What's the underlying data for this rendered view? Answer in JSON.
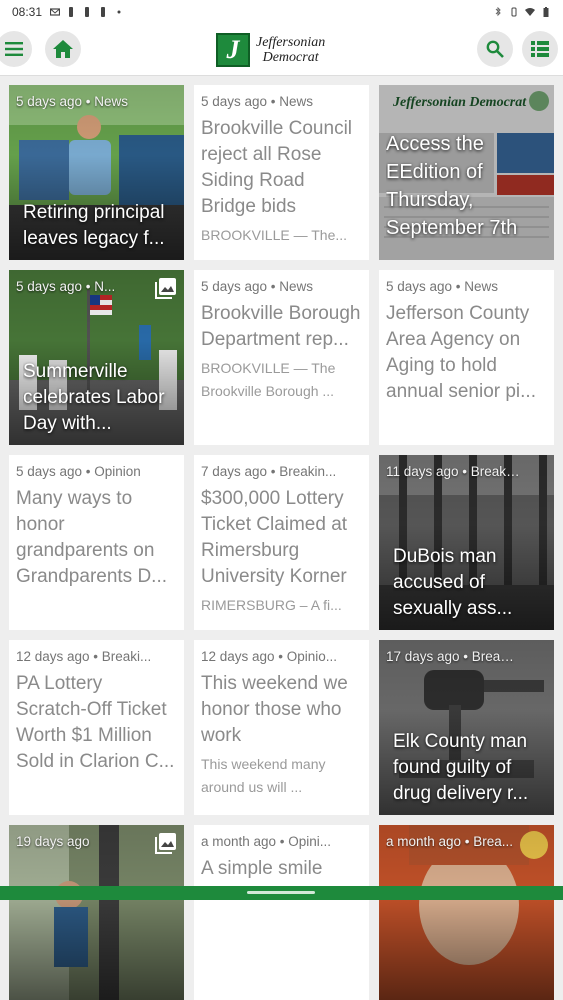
{
  "status": {
    "time": "08:31"
  },
  "appbar": {
    "logo_letter": "J",
    "logo_line1": "Jeffersonian",
    "logo_line2": "Democrat",
    "menu_icon": "menu-icon",
    "home_icon": "home-icon",
    "search_icon": "search-icon",
    "list_icon": "list-view-icon",
    "accent": "#1e8a3c"
  },
  "cards": [
    {
      "meta": "5 days ago • News",
      "headline": "Retiring principal leaves legacy f...",
      "type": "image"
    },
    {
      "meta": "5 days ago • News",
      "headline": "Brookville Council reject all Rose Siding Road Bridge bids",
      "excerpt": "BROOKVILLE — The...",
      "type": "text"
    },
    {
      "meta": "",
      "headline": "Access the EEdition of Thursday, September 7th",
      "newspaper_title": "Jeffersonian Democrat",
      "type": "image"
    },
    {
      "meta": "5 days ago • N...",
      "headline": "Summerville celebrates Labor Day with...",
      "type": "image"
    },
    {
      "meta": "5 days ago • News",
      "headline": "Brookville Borough Department rep...",
      "excerpt": "BROOKVILLE — The Brookville Borough ...",
      "type": "text"
    },
    {
      "meta": "5 days ago • News",
      "headline": "Jefferson County Area Agency on Aging to hold annual senior pi...",
      "type": "text"
    },
    {
      "meta": "5 days ago • Opinion",
      "headline": "Many ways to honor grandparents on Grandparents D...",
      "type": "text"
    },
    {
      "meta": "7 days ago • Breakin...",
      "headline": "$300,000 Lottery Ticket Claimed at Rimersburg University Korner",
      "excerpt": "RIMERSBURG – A fi...",
      "type": "text"
    },
    {
      "meta": "11 days ago • Breaki...",
      "headline": "DuBois man accused of sexually ass...",
      "type": "image"
    },
    {
      "meta": "12 days ago • Breaki...",
      "headline": "PA Lottery Scratch-Off Ticket Worth $1 Million Sold in Clarion C...",
      "type": "text"
    },
    {
      "meta": "12 days ago • Opinio...",
      "headline": "This weekend we honor those who work",
      "excerpt": "This weekend many around us will ...",
      "type": "text"
    },
    {
      "meta": "17 days ago • Breaki...",
      "headline": "Elk County man found guilty of drug delivery r...",
      "type": "image"
    },
    {
      "meta": "19 days ago",
      "headline": "",
      "type": "image"
    },
    {
      "meta": "a month ago • Opini...",
      "headline": "A simple smile",
      "type": "text"
    },
    {
      "meta": "a month ago • Brea...",
      "headline": "",
      "type": "image"
    }
  ]
}
